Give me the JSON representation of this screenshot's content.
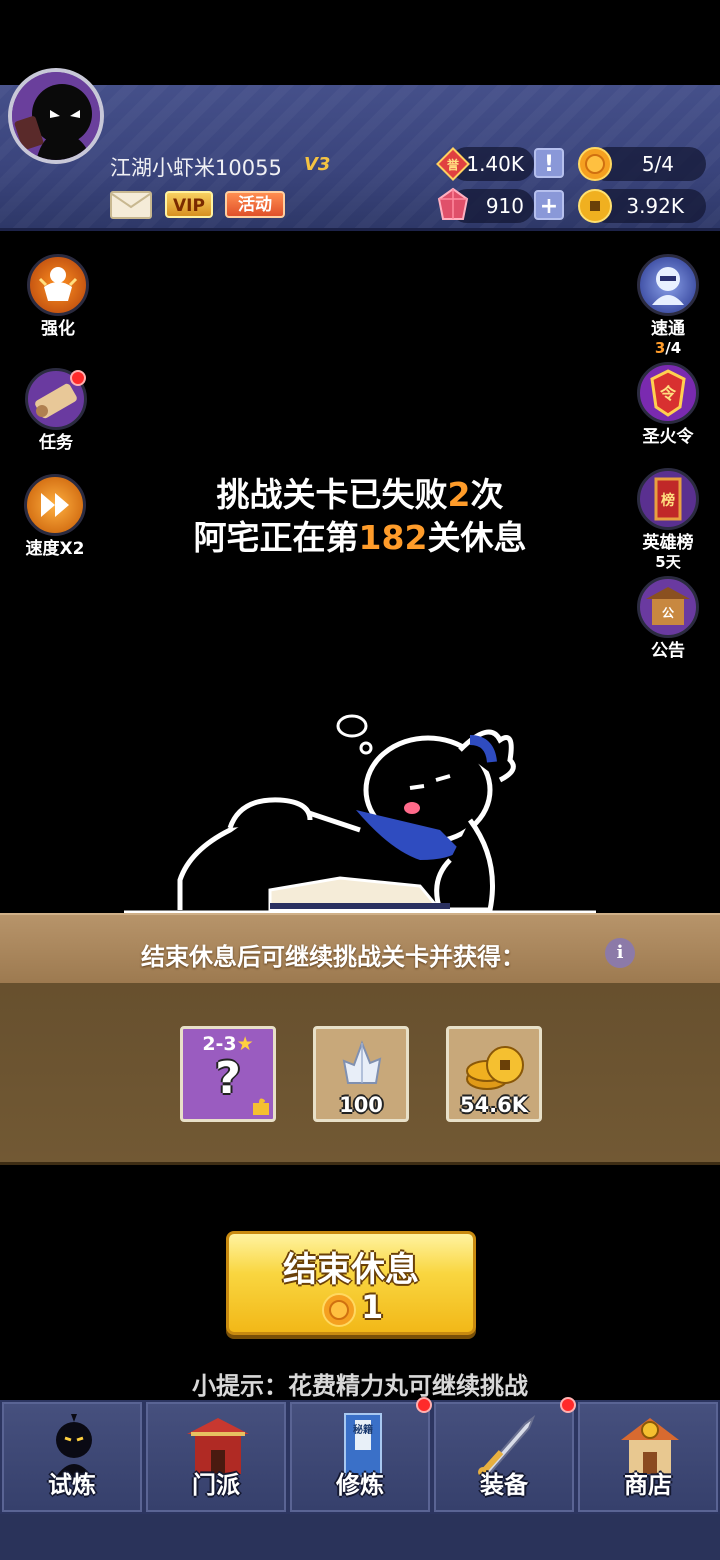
{
  "header": {
    "player_name": "江湖小虾米10055",
    "vip_level": "V3",
    "vip_label": "VIP",
    "event_label": "活动",
    "resources": {
      "honor": "1.40K",
      "honor_btn": "!",
      "gems": "910",
      "gems_btn": "+",
      "energy": "5/4",
      "coins": "3.92K"
    }
  },
  "left_menu": [
    {
      "label": "强化"
    },
    {
      "label": "任务"
    },
    {
      "label": "速度X2"
    }
  ],
  "right_menu": [
    {
      "label": "速通",
      "sub_value": "3",
      "sub_total": "/4"
    },
    {
      "label": "圣火令"
    },
    {
      "label": "英雄榜",
      "sub": "5天"
    },
    {
      "label": "公告"
    }
  ],
  "message": {
    "line1_pre": "挑战关卡已失败",
    "line1_num": "2",
    "line1_post": "次",
    "line2_pre": "阿宅正在第",
    "line2_num": "182",
    "line2_post": "关休息"
  },
  "rewards": {
    "title": "结束休息后可继续挑战关卡并获得：",
    "info_icon": "i",
    "items": [
      {
        "label": "2-3",
        "symbol": "?"
      },
      {
        "qty": "100"
      },
      {
        "qty": "54.6K"
      }
    ]
  },
  "end_rest": {
    "label": "结束休息",
    "cost": "1"
  },
  "tip": "小提示：花费精力丸可继续挑战",
  "bottom_nav": [
    {
      "label": "试炼"
    },
    {
      "label": "门派"
    },
    {
      "label": "修炼",
      "book_text": "秘籍"
    },
    {
      "label": "装备"
    },
    {
      "label": "商店"
    }
  ],
  "colors": {
    "highlight": "#ff9c2a",
    "header_bg": "#3a447c",
    "panel_brown": "#67502e",
    "button_yellow": "#f9d640"
  }
}
